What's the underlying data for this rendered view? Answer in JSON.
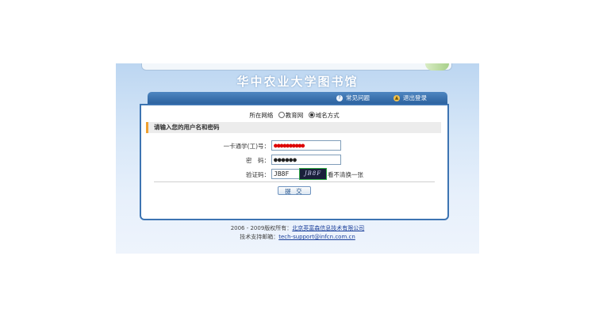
{
  "header": {
    "site_title": "华中农业大学图书馆",
    "nav": {
      "faq": "常见问题",
      "logout": "退出登录"
    }
  },
  "form": {
    "network": {
      "label": "所在网络",
      "options": [
        {
          "label": "教育网",
          "selected": false
        },
        {
          "label": "域名方式",
          "selected": true
        }
      ]
    },
    "section_title": "请输入您的用户名和密码",
    "card_label": "一卡通学(工)号：",
    "card_value": "●●●●●●●●●●",
    "password_label": "密　码：",
    "password_value": "●●●●●●",
    "captcha_label": "验证码：",
    "captcha_value": "JB8F",
    "captcha_image_text": "JB8F",
    "captcha_refresh": "看不清换一张",
    "submit": "提 交"
  },
  "footer": {
    "copyright_prefix": "2006 - 2009版权所有：",
    "company": "北京英富森信息技术有限公司",
    "support_prefix": "技术支持邮箱：",
    "support_email": "tech-support@infcn.com.cn"
  },
  "icons": {
    "faq": "help-icon",
    "logout": "user-exit-icon"
  },
  "colors": {
    "accent": "#3d74b2",
    "section_bar": "#f0a030"
  }
}
